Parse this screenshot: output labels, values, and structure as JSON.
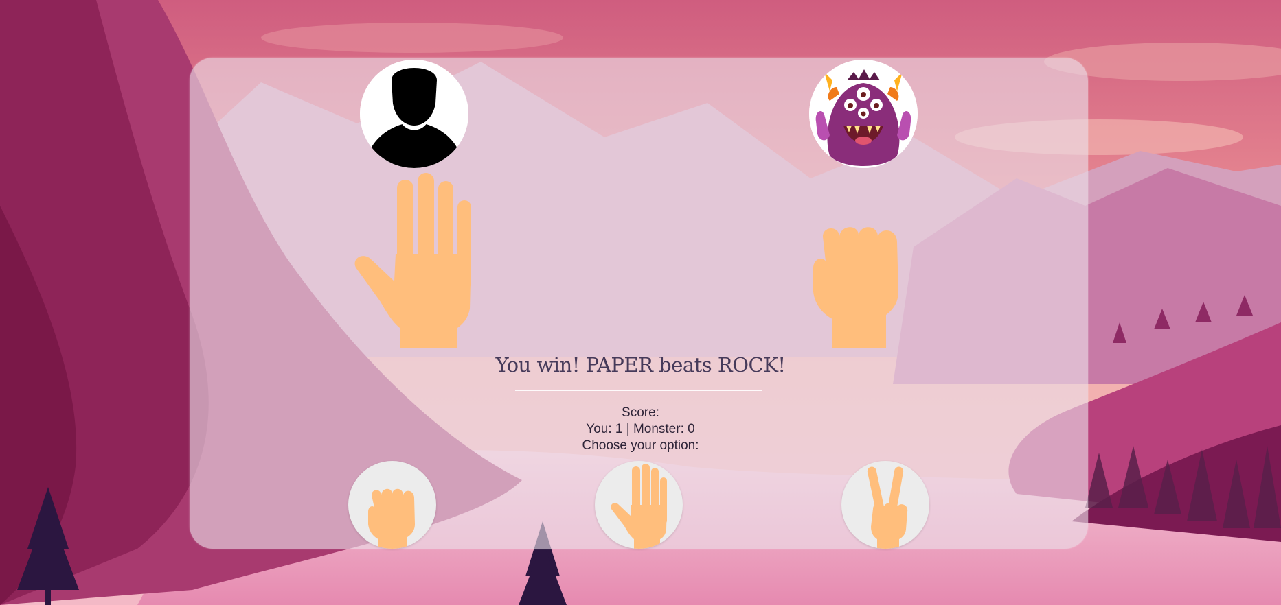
{
  "game": {
    "result_text": "You win! PAPER beats ROCK!",
    "score_label": "Score:",
    "score_text": "You: 1 | Monster: 0",
    "choose_label": "Choose your option:",
    "player_choice": "paper",
    "monster_choice": "rock"
  },
  "options": [
    {
      "name": "rock",
      "icon": "fist-icon"
    },
    {
      "name": "paper",
      "icon": "open-hand-icon"
    },
    {
      "name": "scissors",
      "icon": "peace-hand-icon"
    }
  ],
  "colors": {
    "skin": "#ffbe7c",
    "panel": "#ecdee8",
    "text": "#2e2438",
    "sky": "#d95f80",
    "hills": "#9c2a64"
  }
}
